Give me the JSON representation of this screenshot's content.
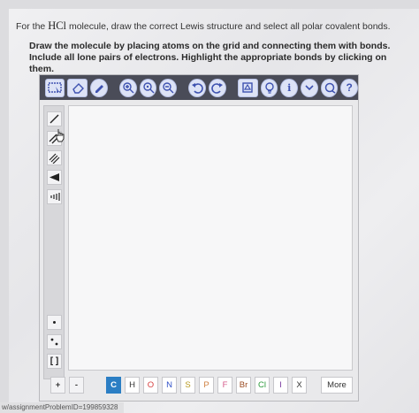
{
  "question": {
    "prefix": "For the",
    "molecule": "HCl",
    "suffix": "molecule, draw the correct Lewis structure and select all polar covalent bonds."
  },
  "instructions": "Draw the molecule by placing atoms on the grid and connecting them with bonds. Include all lone pairs of electrons. Highlight the appropriate bonds by clicking on them.",
  "toolbar": {
    "help_label": "?",
    "info_label": "i"
  },
  "left_tools": {
    "bracket_label": "[ ]",
    "plus_label": "+",
    "minus_label": "-"
  },
  "atoms": {
    "selected": "C",
    "items": [
      "C",
      "H",
      "O",
      "N",
      "S",
      "P",
      "F",
      "Br",
      "Cl",
      "I",
      "X"
    ],
    "more_label": "More"
  },
  "status_bar": "w/assignmentProblemID=199859328",
  "colors": {
    "toolbar_bg": "#4a4c58",
    "active_atom": "#2b7ec4",
    "atom_O": "#d64040",
    "atom_N": "#3050c8",
    "atom_F": "#d65a8a",
    "atom_S": "#b89a20",
    "atom_P": "#d08040",
    "atom_Br": "#9a4a20",
    "atom_Cl": "#2a9a3a"
  }
}
